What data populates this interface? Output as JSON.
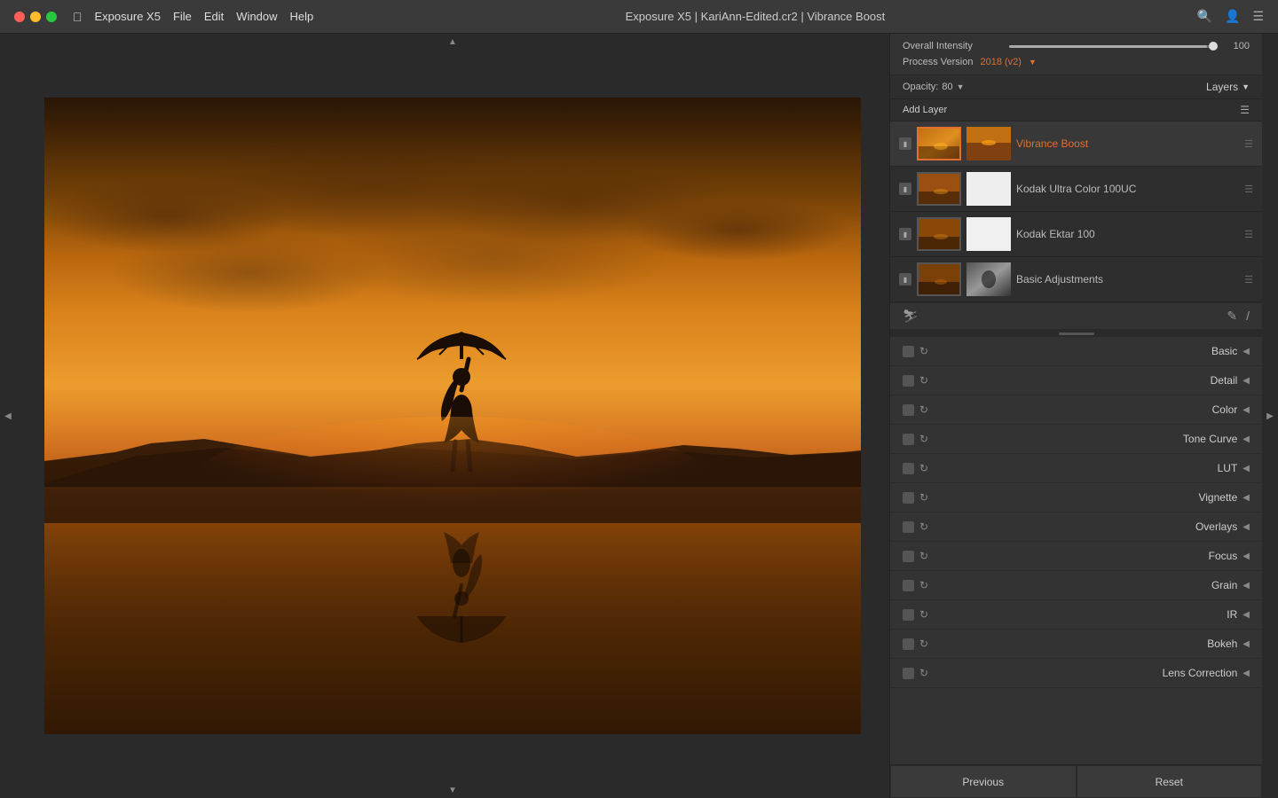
{
  "titlebar": {
    "title": "Exposure X5 | KariAnn-Edited.cr2 | Vibrance Boost",
    "app_name": "Exposure X5",
    "menus": [
      "File",
      "Edit",
      "Window",
      "Help"
    ]
  },
  "panel": {
    "overall_intensity_label": "Overall Intensity",
    "overall_intensity_value": "100",
    "process_version_label": "Process Version",
    "process_version_value": "2018 (v2)",
    "opacity_label": "Opacity:",
    "opacity_value": "80",
    "layers_label": "Layers",
    "add_layer_btn": "Add Layer"
  },
  "layers": [
    {
      "name": "Vibrance Boost",
      "active": true,
      "thumb_type": "photo"
    },
    {
      "name": "Kodak Ultra Color 100UC",
      "active": false,
      "thumb_type": "white"
    },
    {
      "name": "Kodak Ektar 100",
      "active": false,
      "thumb_type": "white"
    },
    {
      "name": "Basic Adjustments",
      "active": false,
      "thumb_type": "bw"
    }
  ],
  "adjustments": [
    {
      "name": "Basic"
    },
    {
      "name": "Detail"
    },
    {
      "name": "Color"
    },
    {
      "name": "Tone Curve"
    },
    {
      "name": "LUT"
    },
    {
      "name": "Vignette"
    },
    {
      "name": "Overlays"
    },
    {
      "name": "Focus"
    },
    {
      "name": "Grain"
    },
    {
      "name": "IR"
    },
    {
      "name": "Bokeh"
    },
    {
      "name": "Lens Correction"
    }
  ],
  "footer": {
    "previous_label": "Previous",
    "reset_label": "Reset"
  }
}
